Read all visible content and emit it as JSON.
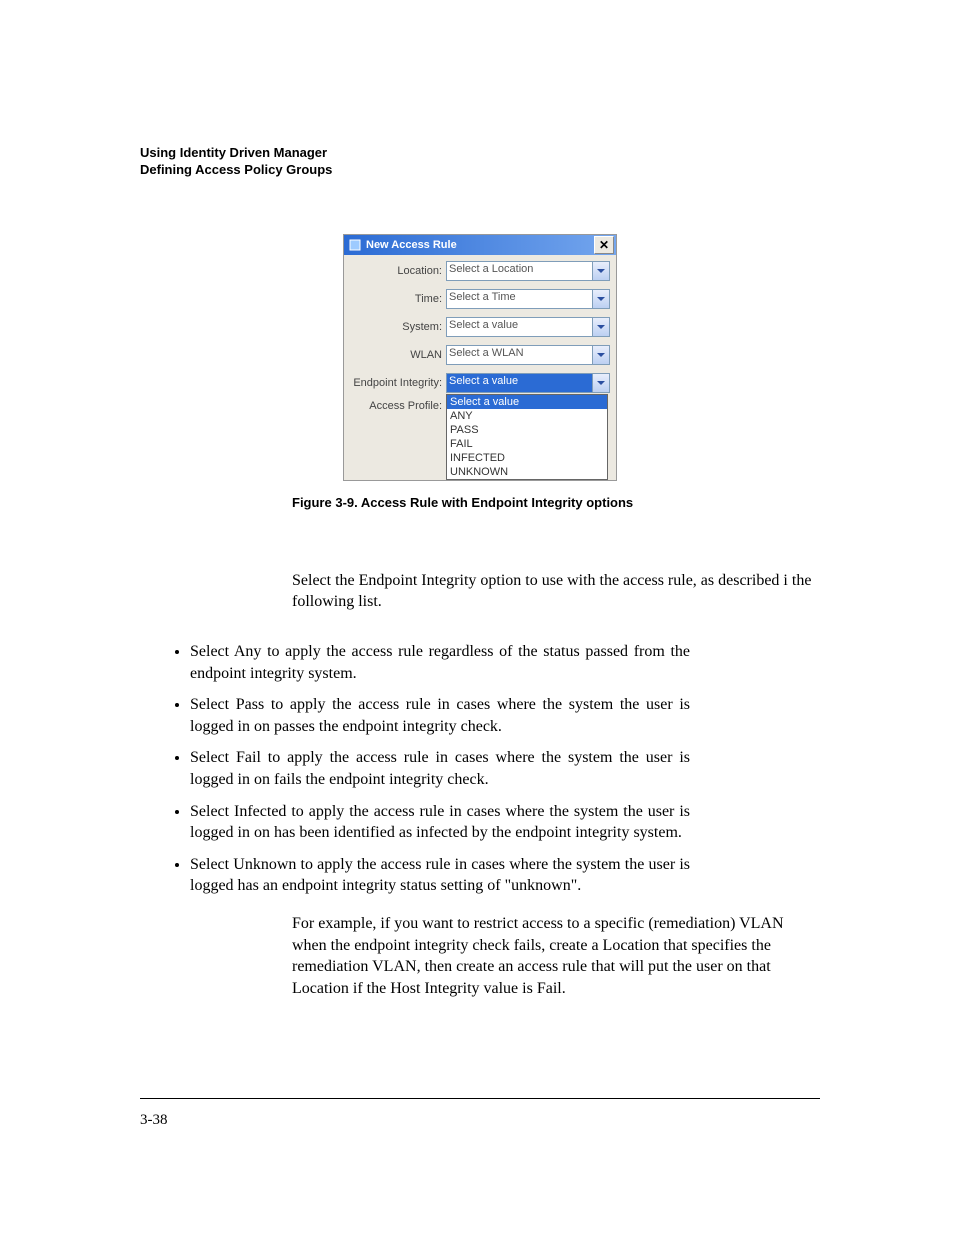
{
  "header": {
    "line1": "Using Identity Driven Manager",
    "line2": "Defining Access Policy Groups"
  },
  "dialog": {
    "title": "New Access Rule",
    "close_glyph": "✕",
    "fields": {
      "location": {
        "label": "Location:",
        "value": "Select a Location"
      },
      "time": {
        "label": "Time:",
        "value": "Select a Time"
      },
      "system": {
        "label": "System:",
        "value": "Select a value"
      },
      "wlan": {
        "label": "WLAN",
        "value": "Select a WLAN"
      },
      "endpoint": {
        "label": "Endpoint Integrity:",
        "value": "Select a value"
      },
      "access_profile_label": "Access Profile:"
    },
    "endpoint_options": [
      "Select a value",
      "ANY",
      "PASS",
      "FAIL",
      "INFECTED",
      "UNKNOWN"
    ]
  },
  "figure_caption": "Figure 3-9. Access Rule with Endpoint Integrity options",
  "intro_para": "Select the Endpoint Integrity option to use with the access rule, as described i the following list.",
  "bullets": [
    "Select Any to apply the access rule regardless of the status passed from the endpoint integrity system.",
    "Select Pass to apply the access rule in cases where the system the user is logged in on passes the endpoint integrity check.",
    "Select Fail to apply the access rule in cases where the system the user is logged in on fails the endpoint integrity check.",
    "Select Infected to apply the access rule in cases where the system the user is logged in on has been identified as infected by the endpoint integrity system.",
    "Select Unknown to apply the access rule in cases where the system the user is logged has an endpoint integrity status setting of \"unknown\"."
  ],
  "closing_para": "For example, if you want to restrict access to a specific (remediation) VLAN when the endpoint integrity check fails, create a Location that specifies the remediation VLAN, then create an access rule that will put the user on that Location if the Host Integrity value is Fail.",
  "page_number": "3-38"
}
